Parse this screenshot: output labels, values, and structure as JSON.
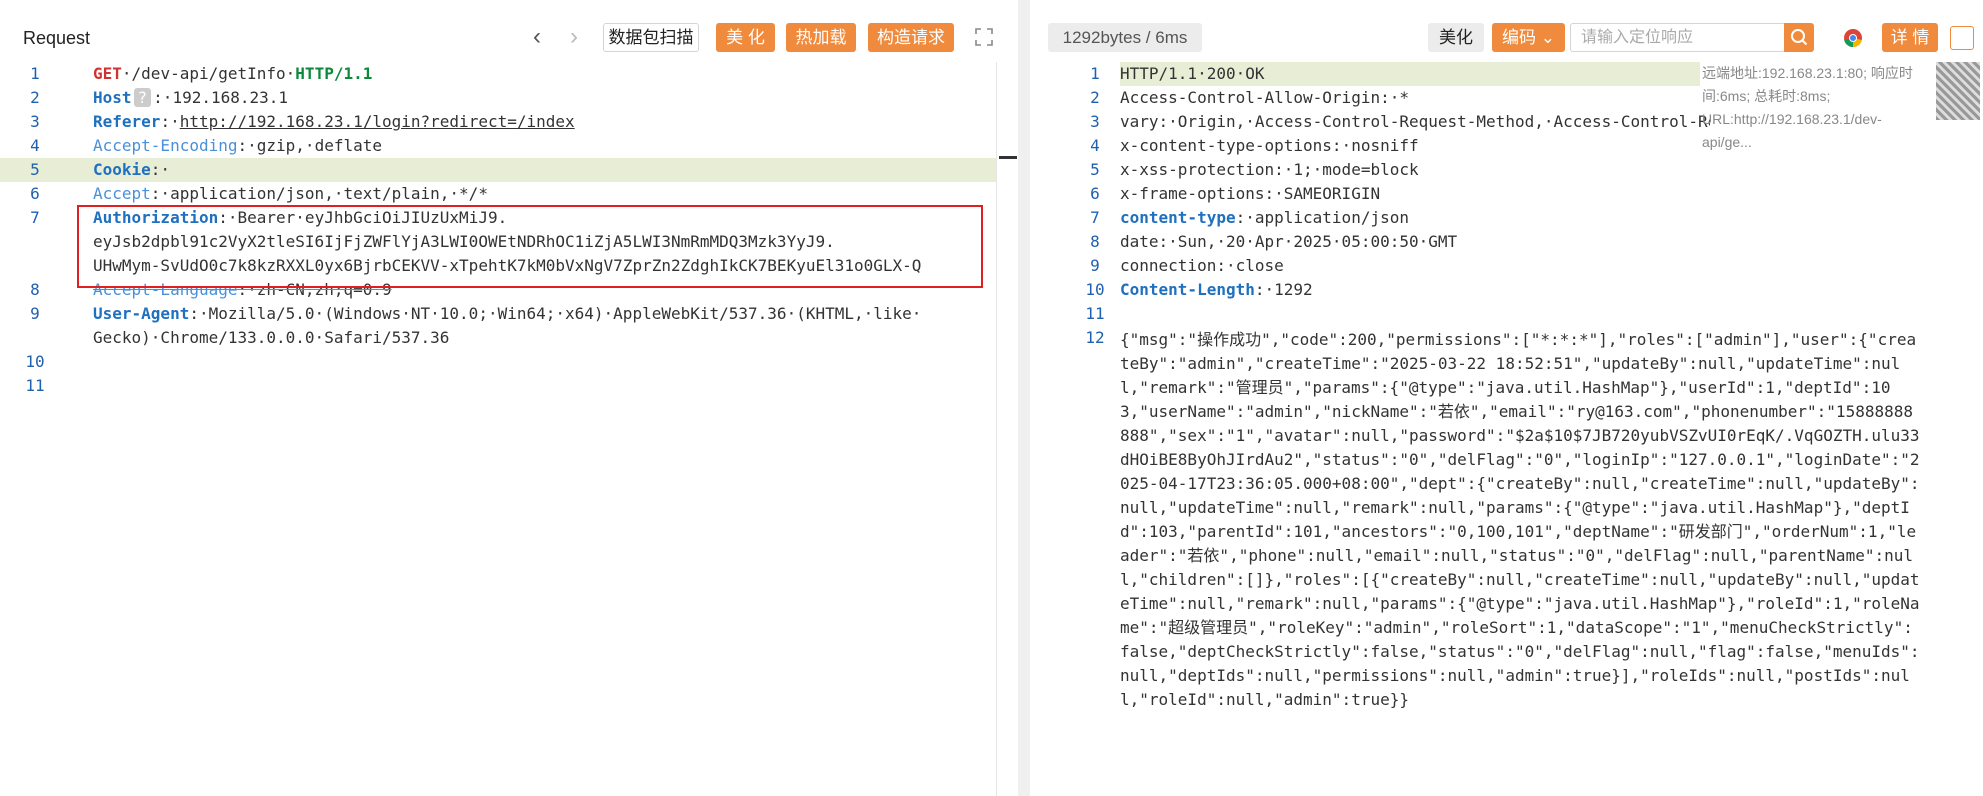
{
  "left": {
    "title": "Request",
    "buttons": {
      "scan": "数据包扫描",
      "beautify": "美 化",
      "hot_load": "热加载",
      "build": "构造请求"
    },
    "lines": [
      {
        "n": "1",
        "method": "GET",
        "path": "·/dev-api/getInfo·",
        "proto": "HTTP/1.1"
      },
      {
        "n": "2",
        "key": "Host",
        "badge": "?",
        "val": ":·192.168.23.1"
      },
      {
        "n": "3",
        "key": "Referer",
        "sep": ":·",
        "url": "http://192.168.23.1/login?redirect=/index"
      },
      {
        "n": "4",
        "key": "Accept-Encoding",
        "val": ":·gzip,·deflate"
      },
      {
        "n": "5",
        "key": "Cookie",
        "val": ":·"
      },
      {
        "n": "6",
        "key": "Accept",
        "val": ":·application/json,·text/plain,·*/*"
      },
      {
        "n": "7",
        "key": "Authorization",
        "val": ":·Bearer·eyJhbGciOiJIUzUxMiJ9.",
        "cont1": "eyJsb2dpbl91c2VyX2tleSI6IjFjZWFlYjA3LWI0OWEtNDRhOC1iZjA5LWI3NmRmMDQ3Mzk3YyJ9.",
        "cont2": "UHwMym-SvUdO0c7k8kzRXXL0yx6BjrbCEKVV-xTpehtK7kM0bVxNgV7ZprZn2ZdghIkCK7BEKyuEl31o0GLX-Q"
      },
      {
        "n": "8",
        "key": "Accept-Language",
        "val": ":·zh-CN,zh;q=0.9"
      },
      {
        "n": "9",
        "key": "User-Agent",
        "val": ":·Mozilla/5.0·(Windows·NT·10.0;·Win64;·x64)·AppleWebKit/537.36·(KHTML,·like·",
        "cont1": "Gecko)·Chrome/133.0.0.0·Safari/537.36"
      },
      {
        "n": "10"
      },
      {
        "n": "11"
      }
    ]
  },
  "right": {
    "stats": "1292bytes / 6ms",
    "buttons": {
      "beautify": "美化",
      "encode": "编码",
      "details": "详 情"
    },
    "search_placeholder": "请输入定位响应",
    "remote_info": "远端地址:192.168.23.1:80; 响应时间:6ms; 总耗时:8ms; URL:http://192.168.23.1/dev-api/ge...",
    "lines": [
      {
        "n": "1",
        "text": "HTTP/1.1·200·OK"
      },
      {
        "n": "2",
        "text": "Access-Control-Allow-Origin:·*"
      },
      {
        "n": "3",
        "text": "vary:·Origin,·Access-Control-Request-Method,·Access-Control-Request-Headers"
      },
      {
        "n": "4",
        "text": "x-content-type-options:·nosniff"
      },
      {
        "n": "5",
        "text": "x-xss-protection:·1;·mode=block"
      },
      {
        "n": "6",
        "text": "x-frame-options:·SAMEORIGIN"
      },
      {
        "n": "7",
        "key": "content-type",
        "val": ":·application/json"
      },
      {
        "n": "8",
        "text": "date:·Sun,·20·Apr·2025·05:00:50·GMT"
      },
      {
        "n": "9",
        "text": "connection:·close"
      },
      {
        "n": "10",
        "key": "Content-Length",
        "val": ":·1292"
      },
      {
        "n": "11"
      },
      {
        "n": "12"
      }
    ],
    "body_json": "{\"msg\":\"操作成功\",\"code\":200,\"permissions\":[\"*:*:*\"],\"roles\":[\"admin\"],\"user\":{\"createBy\":\"admin\",\"createTime\":\"2025-03-22 18:52:51\",\"updateBy\":null,\"updateTime\":null,\"remark\":\"管理员\",\"params\":{\"@type\":\"java.util.HashMap\"},\"userId\":1,\"deptId\":103,\"userName\":\"admin\",\"nickName\":\"若依\",\"email\":\"ry@163.com\",\"phonenumber\":\"15888888888\",\"sex\":\"1\",\"avatar\":null,\"password\":\"$2a$10$7JB720yubVSZvUI0rEqK/.VqGOZTH.ulu33dHOiBE8ByOhJIrdAu2\",\"status\":\"0\",\"delFlag\":\"0\",\"loginIp\":\"127.0.0.1\",\"loginDate\":\"2025-04-17T23:36:05.000+08:00\",\"dept\":{\"createBy\":null,\"createTime\":null,\"updateBy\":null,\"updateTime\":null,\"remark\":null,\"params\":{\"@type\":\"java.util.HashMap\"},\"deptId\":103,\"parentId\":101,\"ancestors\":\"0,100,101\",\"deptName\":\"研发部门\",\"orderNum\":1,\"leader\":\"若依\",\"phone\":null,\"email\":null,\"status\":\"0\",\"delFlag\":null,\"parentName\":null,\"children\":[]},\"roles\":[{\"createBy\":null,\"createTime\":null,\"updateBy\":null,\"updateTime\":null,\"remark\":null,\"params\":{\"@type\":\"java.util.HashMap\"},\"roleId\":1,\"roleName\":\"超级管理员\",\"roleKey\":\"admin\",\"roleSort\":1,\"dataScope\":\"1\",\"menuCheckStrictly\":false,\"deptCheckStrictly\":false,\"status\":\"0\",\"delFlag\":null,\"flag\":false,\"menuIds\":null,\"deptIds\":null,\"permissions\":null,\"admin\":true}],\"roleIds\":null,\"postIds\":null,\"roleId\":null,\"admin\":true}}"
  }
}
